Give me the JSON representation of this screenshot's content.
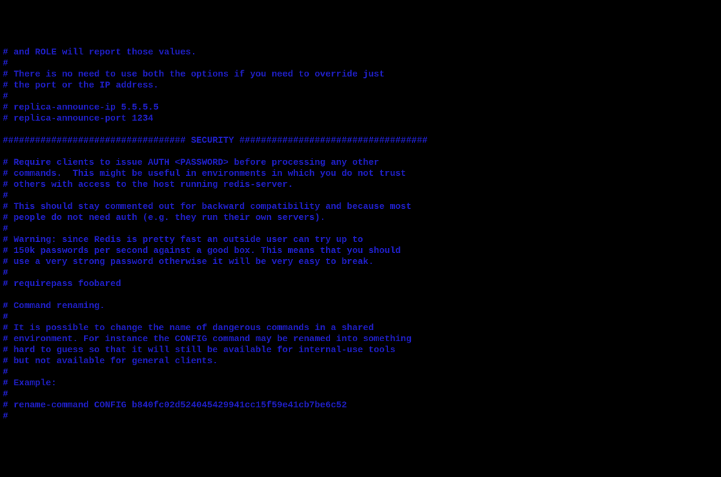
{
  "lines": [
    "# and ROLE will report those values.",
    "#",
    "# There is no need to use both the options if you need to override just",
    "# the port or the IP address.",
    "#",
    "# replica-announce-ip 5.5.5.5",
    "# replica-announce-port 1234",
    "",
    "################################## SECURITY ###################################",
    "",
    "# Require clients to issue AUTH <PASSWORD> before processing any other",
    "# commands.  This might be useful in environments in which you do not trust",
    "# others with access to the host running redis-server.",
    "#",
    "# This should stay commented out for backward compatibility and because most",
    "# people do not need auth (e.g. they run their own servers).",
    "#",
    "# Warning: since Redis is pretty fast an outside user can try up to",
    "# 150k passwords per second against a good box. This means that you should",
    "# use a very strong password otherwise it will be very easy to break.",
    "#",
    "# requirepass foobared",
    "",
    "# Command renaming.",
    "#",
    "# It is possible to change the name of dangerous commands in a shared",
    "# environment. For instance the CONFIG command may be renamed into something",
    "# hard to guess so that it will still be available for internal-use tools",
    "# but not available for general clients.",
    "#",
    "# Example:",
    "#",
    "# rename-command CONFIG b840fc02d524045429941cc15f59e41cb7be6c52",
    "#"
  ]
}
